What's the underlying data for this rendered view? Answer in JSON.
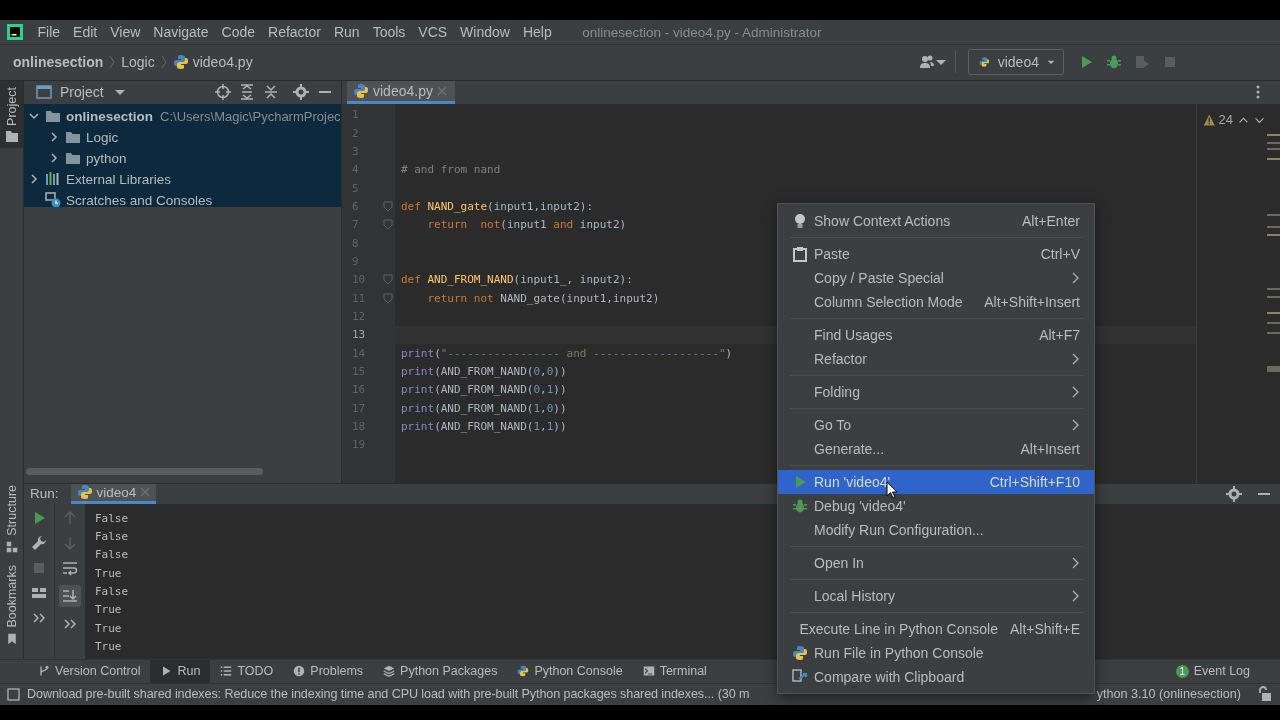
{
  "menu_bar": {
    "items": [
      "File",
      "Edit",
      "View",
      "Navigate",
      "Code",
      "Refactor",
      "Run",
      "Tools",
      "VCS",
      "Window",
      "Help"
    ],
    "title": "onlinesection - video4.py - Administrator"
  },
  "breadcrumbs": [
    "onlinesection",
    "Logic",
    "video4.py"
  ],
  "run_config": {
    "label": "video4"
  },
  "side_stripe": {
    "top": [
      {
        "label": "Project",
        "selected": true
      }
    ],
    "bottom": [
      {
        "label": "Structure",
        "kind": "structure",
        "selected": false
      },
      {
        "label": "Bookmarks",
        "kind": "bookmark",
        "selected": false
      }
    ]
  },
  "project_panel": {
    "title": "Project",
    "tree": [
      {
        "label": "onlinesection",
        "hint": "C:\\Users\\Magic\\PycharmProjec",
        "kind": "folder",
        "expanded": true,
        "children": [
          {
            "label": "Logic",
            "kind": "folder",
            "expanded": false
          },
          {
            "label": "python",
            "kind": "folder",
            "expanded": false
          }
        ]
      },
      {
        "label": "External Libraries",
        "kind": "library",
        "expanded": false
      },
      {
        "label": "Scratches and Consoles",
        "kind": "scratch"
      }
    ]
  },
  "editor": {
    "tabs": [
      {
        "label": "video4.py",
        "selected": true
      }
    ],
    "warnings": "24",
    "lines": [
      {
        "number": "1",
        "current": false
      },
      {
        "number": "2",
        "current": false
      },
      {
        "number": "3",
        "current": false
      },
      {
        "number": "4",
        "current": false,
        "tokens": [
          {
            "kind": "comment",
            "text": "# and from nand"
          }
        ]
      },
      {
        "number": "5",
        "current": false
      },
      {
        "number": "6",
        "current": false,
        "fold": true,
        "tokens": [
          {
            "kind": "keyword",
            "text": "def "
          },
          {
            "kind": "function",
            "text": "NAND_gate"
          },
          {
            "kind": "plain",
            "text": "(input1,input2):"
          }
        ]
      },
      {
        "number": "7",
        "current": false,
        "fold": true,
        "tokens": [
          {
            "kind": "keyword",
            "text": "    return"
          },
          {
            "kind": "keyword",
            "text": "  not"
          },
          {
            "kind": "plain",
            "text": "(input1 "
          },
          {
            "kind": "keyword",
            "text": "and"
          },
          {
            "kind": "plain",
            "text": " input2)"
          }
        ]
      },
      {
        "number": "8",
        "current": false
      },
      {
        "number": "9",
        "current": false
      },
      {
        "number": "10",
        "current": false,
        "fold": true,
        "tokens": [
          {
            "kind": "keyword",
            "text": "def "
          },
          {
            "kind": "function",
            "text": "AND_FROM_NAND"
          },
          {
            "kind": "plain",
            "text": "(input1_, input2):"
          }
        ]
      },
      {
        "number": "11",
        "current": false,
        "fold": true,
        "tokens": [
          {
            "kind": "keyword",
            "text": "    return not"
          },
          {
            "kind": "plain",
            "text": " NAND_gate(input1,input2)"
          }
        ]
      },
      {
        "number": "12",
        "current": false
      },
      {
        "number": "13",
        "current": true
      },
      {
        "number": "14",
        "current": false,
        "tokens": [
          {
            "kind": "builtin",
            "text": "print"
          },
          {
            "kind": "plain",
            "text": "("
          },
          {
            "kind": "string",
            "text": "\"----------------- and -------------------\""
          },
          {
            "kind": "plain",
            "text": ")"
          }
        ]
      },
      {
        "number": "15",
        "current": false,
        "tokens": [
          {
            "kind": "builtin",
            "text": "print"
          },
          {
            "kind": "plain",
            "text": "(AND_FROM_NAND("
          },
          {
            "kind": "number",
            "text": "0"
          },
          {
            "kind": "plain",
            "text": ","
          },
          {
            "kind": "number",
            "text": "0"
          },
          {
            "kind": "plain",
            "text": "))"
          }
        ]
      },
      {
        "number": "16",
        "current": false,
        "tokens": [
          {
            "kind": "builtin",
            "text": "print"
          },
          {
            "kind": "plain",
            "text": "(AND_FROM_NAND("
          },
          {
            "kind": "number",
            "text": "0"
          },
          {
            "kind": "plain",
            "text": ","
          },
          {
            "kind": "number",
            "text": "1"
          },
          {
            "kind": "plain",
            "text": "))"
          }
        ]
      },
      {
        "number": "17",
        "current": false,
        "tokens": [
          {
            "kind": "builtin",
            "text": "print"
          },
          {
            "kind": "plain",
            "text": "(AND_FROM_NAND("
          },
          {
            "kind": "number",
            "text": "1"
          },
          {
            "kind": "plain",
            "text": ","
          },
          {
            "kind": "number",
            "text": "0"
          },
          {
            "kind": "plain",
            "text": "))"
          }
        ]
      },
      {
        "number": "18",
        "current": false,
        "tokens": [
          {
            "kind": "builtin",
            "text": "print"
          },
          {
            "kind": "plain",
            "text": "(AND_FROM_NAND("
          },
          {
            "kind": "number",
            "text": "1"
          },
          {
            "kind": "plain",
            "text": ","
          },
          {
            "kind": "number",
            "text": "1"
          },
          {
            "kind": "plain",
            "text": "))"
          }
        ]
      },
      {
        "number": "19",
        "current": false
      }
    ]
  },
  "run_panel": {
    "label": "Run:",
    "tabs": [
      {
        "label": "video4",
        "selected": true
      }
    ],
    "output": [
      "False",
      "False",
      "False",
      "True",
      "False",
      "True",
      "True",
      "True"
    ]
  },
  "tool_bar": {
    "items": [
      {
        "label": "Version Control",
        "kind": "vcs",
        "selected": false
      },
      {
        "label": "Run",
        "kind": "run",
        "selected": true
      },
      {
        "label": "TODO",
        "kind": "todo",
        "selected": false
      },
      {
        "label": "Problems",
        "kind": "problems",
        "selected": false
      },
      {
        "label": "Python Packages",
        "kind": "packages",
        "selected": false
      },
      {
        "label": "Python Console",
        "kind": "console",
        "selected": false
      },
      {
        "label": "Terminal",
        "kind": "terminal",
        "selected": false
      }
    ],
    "event_log": {
      "label": "Event Log",
      "count": "1"
    }
  },
  "status_bar": {
    "message": "Download pre-built shared indexes: Reduce the indexing time and CPU load with pre-built Python packages shared indexes... (30 m",
    "interpreter": "ython 3.10 (onlinesection)"
  },
  "context_menu": {
    "groups": [
      [
        {
          "label": "Show Context Actions",
          "shortcut": "Alt+Enter",
          "kind": "bulb",
          "submenu": false,
          "selected": false
        }
      ],
      [
        {
          "label": "Paste",
          "shortcut": "Ctrl+V",
          "kind": "paste",
          "submenu": false,
          "selected": false
        },
        {
          "label": "Copy / Paste Special",
          "kind": "plain",
          "submenu": true,
          "selected": false
        },
        {
          "label": "Column Selection Mode",
          "shortcut": "Alt+Shift+Insert",
          "kind": "plain",
          "submenu": false,
          "selected": false
        }
      ],
      [
        {
          "label": "Find Usages",
          "shortcut": "Alt+F7",
          "kind": "plain",
          "submenu": false,
          "selected": false
        },
        {
          "label": "Refactor",
          "kind": "plain",
          "submenu": true,
          "selected": false
        }
      ],
      [
        {
          "label": "Folding",
          "kind": "plain",
          "submenu": true,
          "selected": false
        }
      ],
      [
        {
          "label": "Go To",
          "kind": "plain",
          "submenu": true,
          "selected": false
        },
        {
          "label": "Generate...",
          "shortcut": "Alt+Insert",
          "kind": "plain",
          "submenu": false,
          "selected": false
        }
      ],
      [
        {
          "label": "Run 'video4'",
          "shortcut": "Ctrl+Shift+F10",
          "kind": "run",
          "submenu": false,
          "selected": true
        },
        {
          "label": "Debug 'video4'",
          "kind": "debug",
          "submenu": false,
          "selected": false
        },
        {
          "label": "Modify Run Configuration...",
          "kind": "plain",
          "submenu": false,
          "selected": false
        }
      ],
      [
        {
          "label": "Open In",
          "kind": "plain",
          "submenu": true,
          "selected": false
        }
      ],
      [
        {
          "label": "Local History",
          "kind": "plain",
          "submenu": true,
          "selected": false
        }
      ],
      [
        {
          "label": "Execute Line in Python Console",
          "shortcut": "Alt+Shift+E",
          "kind": "plain",
          "submenu": false,
          "selected": false
        },
        {
          "label": "Run File in Python Console",
          "kind": "python",
          "submenu": false,
          "selected": false
        },
        {
          "label": "Compare with Clipboard",
          "kind": "compare",
          "submenu": false,
          "selected": false
        }
      ]
    ]
  }
}
